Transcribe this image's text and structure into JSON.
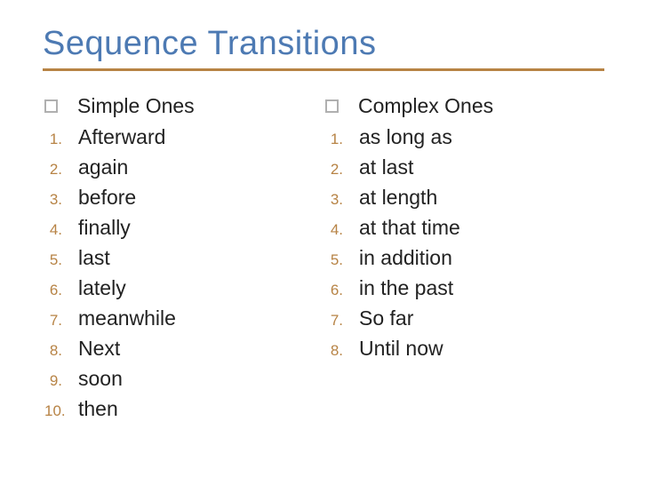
{
  "title": "Sequence Transitions",
  "left": {
    "heading": "Simple Ones",
    "items": [
      "Afterward",
      "again",
      "before",
      "finally",
      "last",
      "lately",
      "meanwhile",
      "Next",
      "soon",
      "then"
    ]
  },
  "right": {
    "heading": "Complex Ones",
    "items": [
      "as long as",
      "at last",
      "at length",
      "at that time",
      "in addition",
      "in the past",
      "So far",
      "Until now"
    ]
  }
}
